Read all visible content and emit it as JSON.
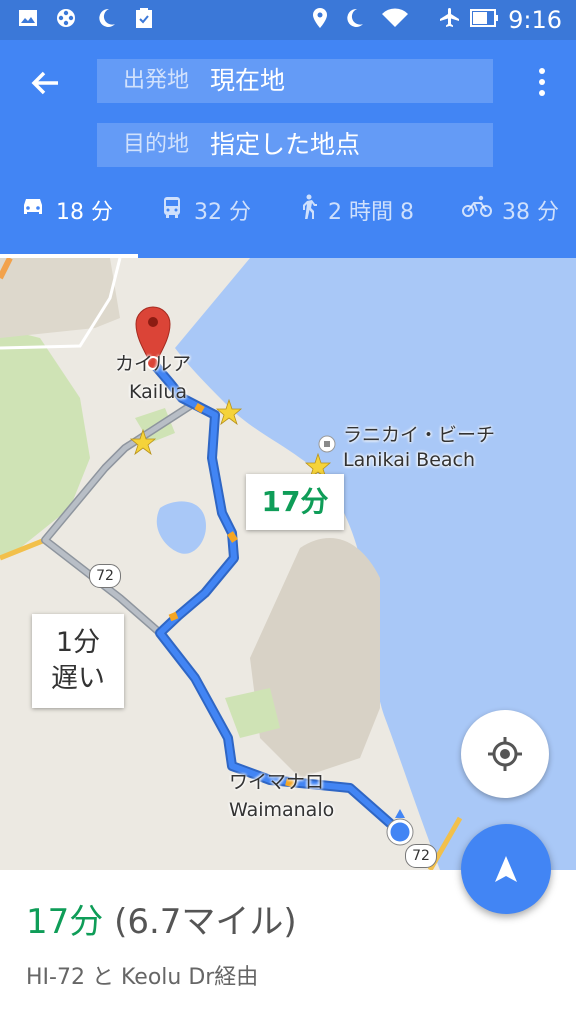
{
  "status_bar": {
    "left_icons": [
      "image-icon",
      "film-reel-icon",
      "moon-icon",
      "clipboard-check-icon"
    ],
    "right_icons": [
      "location-pin-icon",
      "moon-icon",
      "wifi-icon",
      "airplane-icon",
      "battery-icon"
    ],
    "time": "9:16"
  },
  "directions": {
    "origin_label": "出発地",
    "origin_value": "現在地",
    "destination_label": "目的地",
    "destination_value": "指定した地点"
  },
  "tabs": [
    {
      "mode": "car",
      "icon": "car-icon",
      "label": "18 分",
      "active": true
    },
    {
      "mode": "transit",
      "icon": "bus-icon",
      "label": "32 分",
      "active": false
    },
    {
      "mode": "walk",
      "icon": "walking-icon",
      "label": "2 時間 8",
      "active": false
    },
    {
      "mode": "bike",
      "icon": "bicycle-icon",
      "label": "38 分",
      "active": false
    }
  ],
  "map": {
    "labels": {
      "kailua_jp": "カイルア",
      "kailua_en": "Kailua",
      "lanikai_jp": "ラニカイ・ビーチ",
      "lanikai_en": "Lanikai Beach",
      "waimanalo_jp": "ワイマナロ",
      "waimanalo_en": "Waimanalo",
      "route_shield_1": "72",
      "route_shield_2": "72"
    },
    "callout_main": "17分",
    "callout_alt_line1": "1分",
    "callout_alt_line2": "遅い",
    "colors": {
      "route": "#4285f4",
      "alt_route": "#9aa3ad",
      "water": "#a9c8f7",
      "land": "#ece9e2",
      "park": "#cfe3b5",
      "pin": "#db4437"
    }
  },
  "summary": {
    "duration": "17分",
    "distance": "(6.7マイル)",
    "via": "HI-72 と Keolu Dr経由"
  },
  "buttons": {
    "my_location_icon": "crosshair-icon",
    "navigate_icon": "navigation-arrow-icon"
  }
}
